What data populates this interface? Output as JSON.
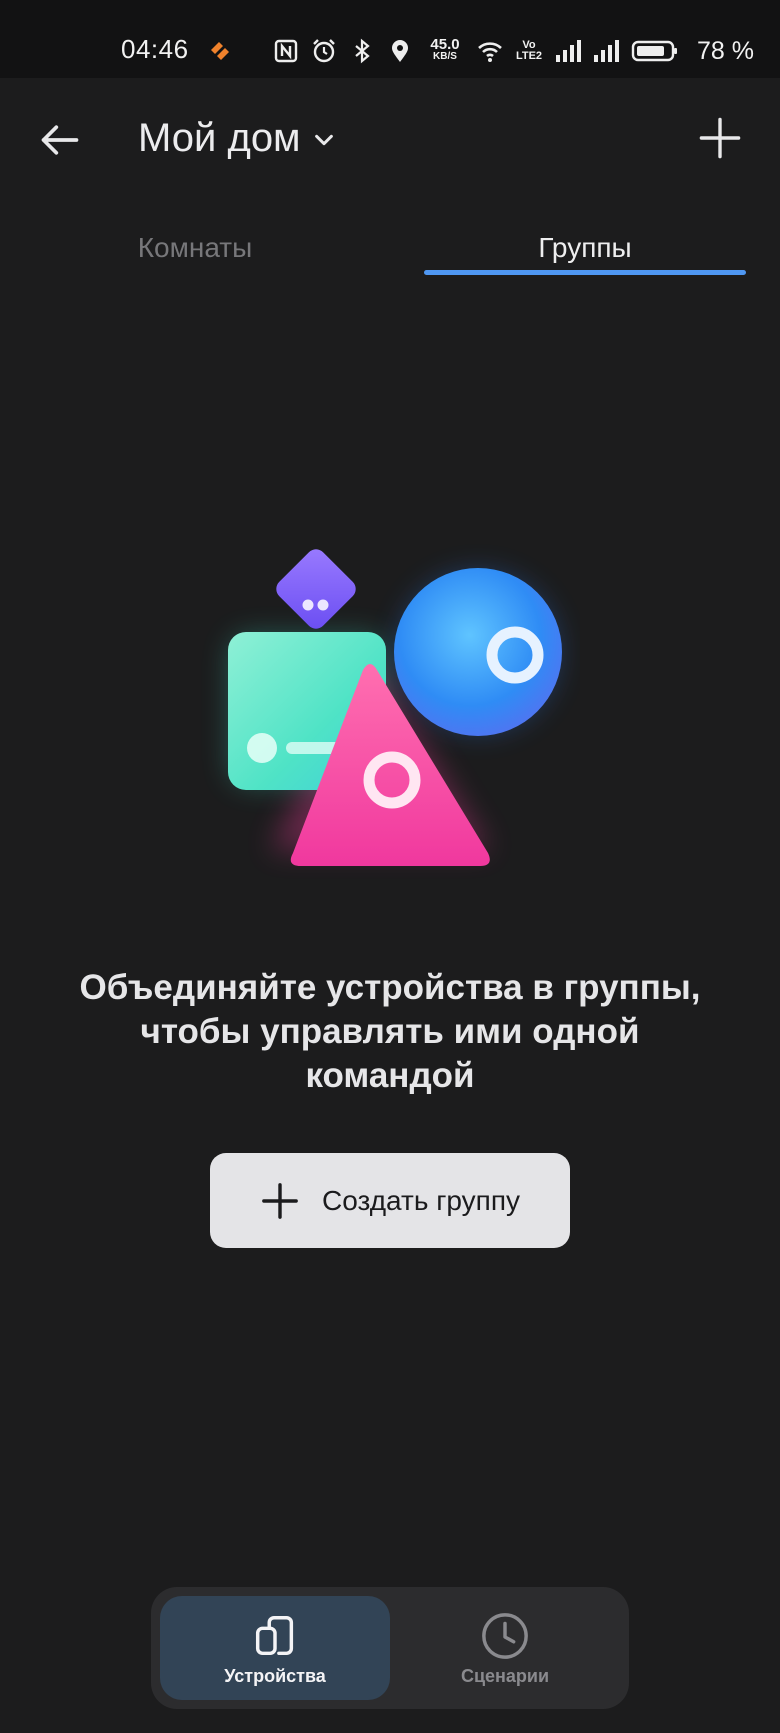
{
  "status_bar": {
    "time": "04:46",
    "speed_value": "45.0",
    "speed_unit": "KB/S",
    "volte_top": "Vo",
    "volte_bottom": "LTE2",
    "battery_percent": "78 %",
    "icons": [
      "app-notification-icon",
      "nfc-icon",
      "alarm-icon",
      "bluetooth-icon",
      "location-icon",
      "wifi-icon",
      "signal-icon",
      "signal-icon",
      "battery-icon"
    ]
  },
  "header": {
    "title": "Мой дом",
    "back_icon": "arrow-left-icon",
    "dropdown_icon": "chevron-down-icon",
    "add_icon": "plus-icon"
  },
  "tabs": [
    {
      "label": "Комнаты",
      "active": false
    },
    {
      "label": "Группы",
      "active": true
    }
  ],
  "empty_state": {
    "message": "Объединяйте устройства в группы, чтобы управлять ими одной командой",
    "button_label": "Создать группу"
  },
  "bottom_nav": [
    {
      "label": "Устройства",
      "icon": "devices-icon",
      "active": true
    },
    {
      "label": "Сценарии",
      "icon": "clock-icon",
      "active": false
    }
  ],
  "colors": {
    "accent": "#4f97f2",
    "background": "#1c1c1d",
    "active_nav": "#324456"
  }
}
